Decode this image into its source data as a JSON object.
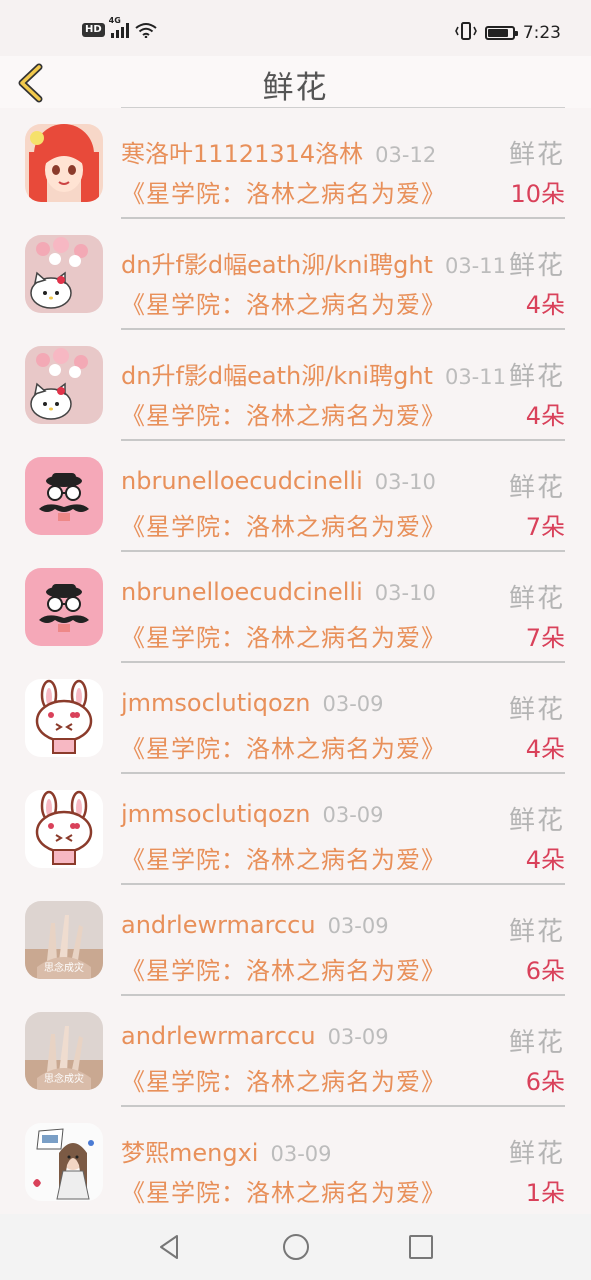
{
  "status_bar": {
    "network_badge": "HD",
    "network_type": "4G",
    "time": "7:23",
    "battery_level": 0.85
  },
  "header": {
    "title": "鲜花",
    "back_icon": "chevron-left-icon"
  },
  "gift_list": [
    {
      "user": "寒洛叶11121314洛林",
      "date": "03-12",
      "gift_type": "鲜花",
      "book": "《星学院：洛林之病名为爱》",
      "count": "10朵",
      "avatar": "anime-girl"
    },
    {
      "user": "dn升f影d幅eath泖/kni聘ght",
      "date": "03-11",
      "gift_type": "鲜花",
      "book": "《星学院：洛林之病名为爱》",
      "count": "4朵",
      "avatar": "hello-kitty"
    },
    {
      "user": "dn升f影d幅eath泖/kni聘ght",
      "date": "03-11",
      "gift_type": "鲜花",
      "book": "《星学院：洛林之病名为爱》",
      "count": "4朵",
      "avatar": "hello-kitty"
    },
    {
      "user": "nbrunelloecudcinelli",
      "date": "03-10",
      "gift_type": "鲜花",
      "book": "《星学院：洛林之病名为爱》",
      "count": "7朵",
      "avatar": "mustache"
    },
    {
      "user": "nbrunelloecudcinelli",
      "date": "03-10",
      "gift_type": "鲜花",
      "book": "《星学院：洛林之病名为爱》",
      "count": "7朵",
      "avatar": "mustache"
    },
    {
      "user": "jmmsoclutiqozn",
      "date": "03-09",
      "gift_type": "鲜花",
      "book": "《星学院：洛林之病名为爱》",
      "count": "4朵",
      "avatar": "bunny"
    },
    {
      "user": "jmmsoclutiqozn",
      "date": "03-09",
      "gift_type": "鲜花",
      "book": "《星学院：洛林之病名为爱》",
      "count": "4朵",
      "avatar": "bunny"
    },
    {
      "user": "andrlewrmarccu",
      "date": "03-09",
      "gift_type": "鲜花",
      "book": "《星学院：洛林之病名为爱》",
      "count": "6朵",
      "avatar": "hands-photo"
    },
    {
      "user": "andrlewrmarccu",
      "date": "03-09",
      "gift_type": "鲜花",
      "book": "《星学院：洛林之病名为爱》",
      "count": "6朵",
      "avatar": "hands-photo"
    },
    {
      "user": "梦熙mengxi",
      "date": "03-09",
      "gift_type": "鲜花",
      "book": "《星学院：洛林之病名为爱》",
      "count": "1朵",
      "avatar": "sketch-girl"
    }
  ],
  "nav_bar": {
    "back": "back-triangle-icon",
    "home": "home-circle-icon",
    "recents": "recents-square-icon"
  },
  "colors": {
    "username": "#e8905a",
    "count": "#d9415a",
    "muted": "#bcbcbc",
    "background": "#f8f4f4"
  }
}
